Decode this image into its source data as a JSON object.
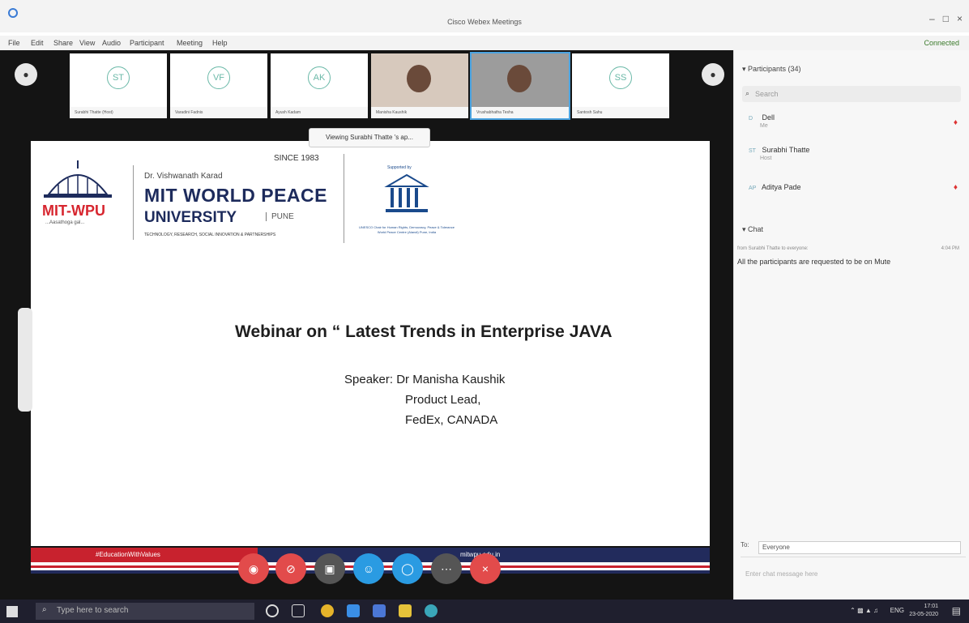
{
  "window": {
    "title": "Cisco Webex Meetings",
    "status": "Connected"
  },
  "menu": [
    "File",
    "Edit",
    "Share",
    "View",
    "Audio",
    "Participant",
    "Meeting",
    "Help"
  ],
  "thumbnails": [
    {
      "initials": "ST",
      "name": "Surabhi Thatte (Host)"
    },
    {
      "initials": "VF",
      "name": "Varadini Fadnis"
    },
    {
      "initials": "AK",
      "name": "Ayush Kadam"
    },
    {
      "initials": "",
      "name": "Manisha Kaushik"
    },
    {
      "initials": "",
      "name": "Vrushabhatha Tesha"
    },
    {
      "initials": "SS",
      "name": "Santosh Sahu"
    }
  ],
  "viewing_banner": "Viewing Surabhi Thatte 's ap...",
  "slide": {
    "since": "SINCE 1983",
    "mit_wpu": "MIT-WPU",
    "tagline": "...Aasathoga gal...",
    "karad": "Dr. Vishwanath Karad",
    "mit_world_peace": "MIT WORLD PEACE",
    "university": "UNIVERSITY",
    "pune": "PUNE",
    "techline": "TECHNOLOGY, RESEARCH, SOCIAL INNOVATION & PARTNERSHIPS",
    "supported_by": "Supported by",
    "unesco_text": "UNESCO Chair for Human Rights, Democracy, Peace & Tolerance World Peace Centre (Alandi) Pune, India",
    "title": "Webinar on “ Latest Trends in Enterprise JAVA",
    "speaker": "Speaker: Dr Manisha Kaushik\n                  Product Lead,\n                  FedEx, CANADA",
    "hashtag": "#EducationWithValues",
    "footer_url": "mitwpu.edu.in"
  },
  "participants": {
    "title": "Participants (34)",
    "search_placeholder": "Search",
    "list": [
      {
        "initials": "D",
        "name": "Dell",
        "sub": "Me"
      },
      {
        "initials": "ST",
        "name": "Surabhi Thatte",
        "sub": "Host"
      },
      {
        "initials": "AP",
        "name": "Aditya Pade",
        "sub": ""
      }
    ]
  },
  "chat": {
    "title": "Chat",
    "from": "from Surabhi Thatte to everyone:",
    "time": "4:04 PM",
    "message": "All the participants are requested to be on Mute",
    "to_label": "To:",
    "to_value": "Everyone",
    "input_placeholder": "Enter chat message here"
  },
  "taskbar": {
    "search_placeholder": "Type here to search",
    "lang": "ENG",
    "time": "17:01",
    "date": "23-05-2020"
  },
  "colors": {
    "accent": "#2a9be2",
    "danger": "#e24b4b",
    "brand_red": "#c8222e",
    "brand_navy": "#1d2b5c"
  }
}
